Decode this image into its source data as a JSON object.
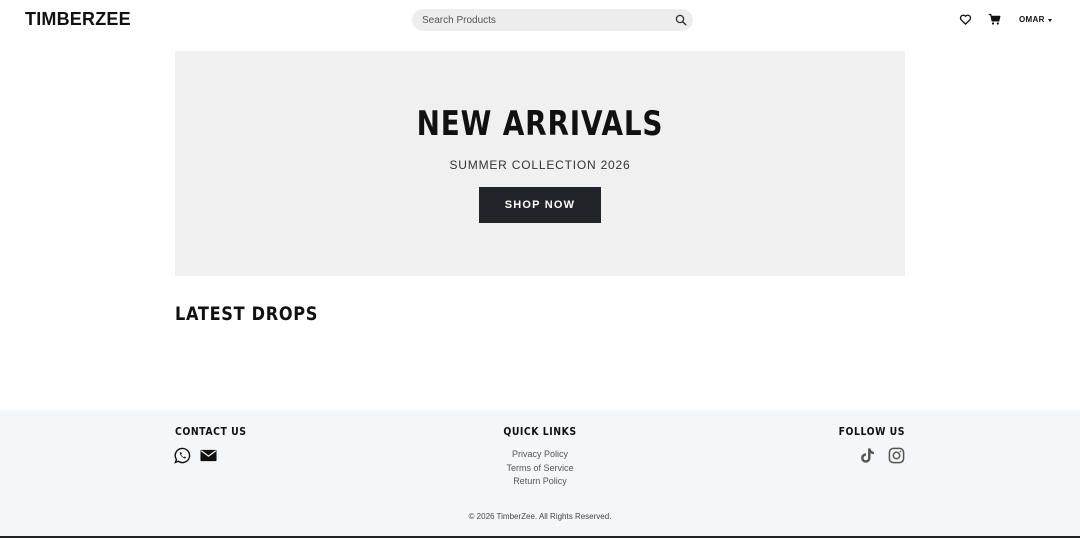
{
  "header": {
    "logo": "TIMBERZEE",
    "search": {
      "placeholder": "Search Products"
    },
    "user": {
      "name": "OMAR"
    },
    "icons": {
      "wishlist": "heart-icon",
      "cart": "cart-icon",
      "search": "search-icon"
    }
  },
  "hero": {
    "title": "NEW ARRIVALS",
    "subtitle": "SUMMER COLLECTION 2026",
    "button": "SHOP NOW"
  },
  "latest": {
    "title": "LATEST DROPS"
  },
  "footer": {
    "contact_title": "CONTACT US",
    "contact_icons": [
      "whatsapp-icon",
      "mail-icon"
    ],
    "quick_title": "QUICK LINKS",
    "links": [
      "Privacy Policy",
      "Terms of Service",
      "Return Policy"
    ],
    "follow_title": "FOLLOW US",
    "follow_icons": [
      "tiktok-icon",
      "instagram-icon"
    ],
    "copyright": "© 2026 TimberZee. All Rights Reserved."
  },
  "colors": {
    "button_bg": "#212529",
    "hero_bg": "#f0f0f0",
    "footer_bg": "#f5f6f7"
  }
}
